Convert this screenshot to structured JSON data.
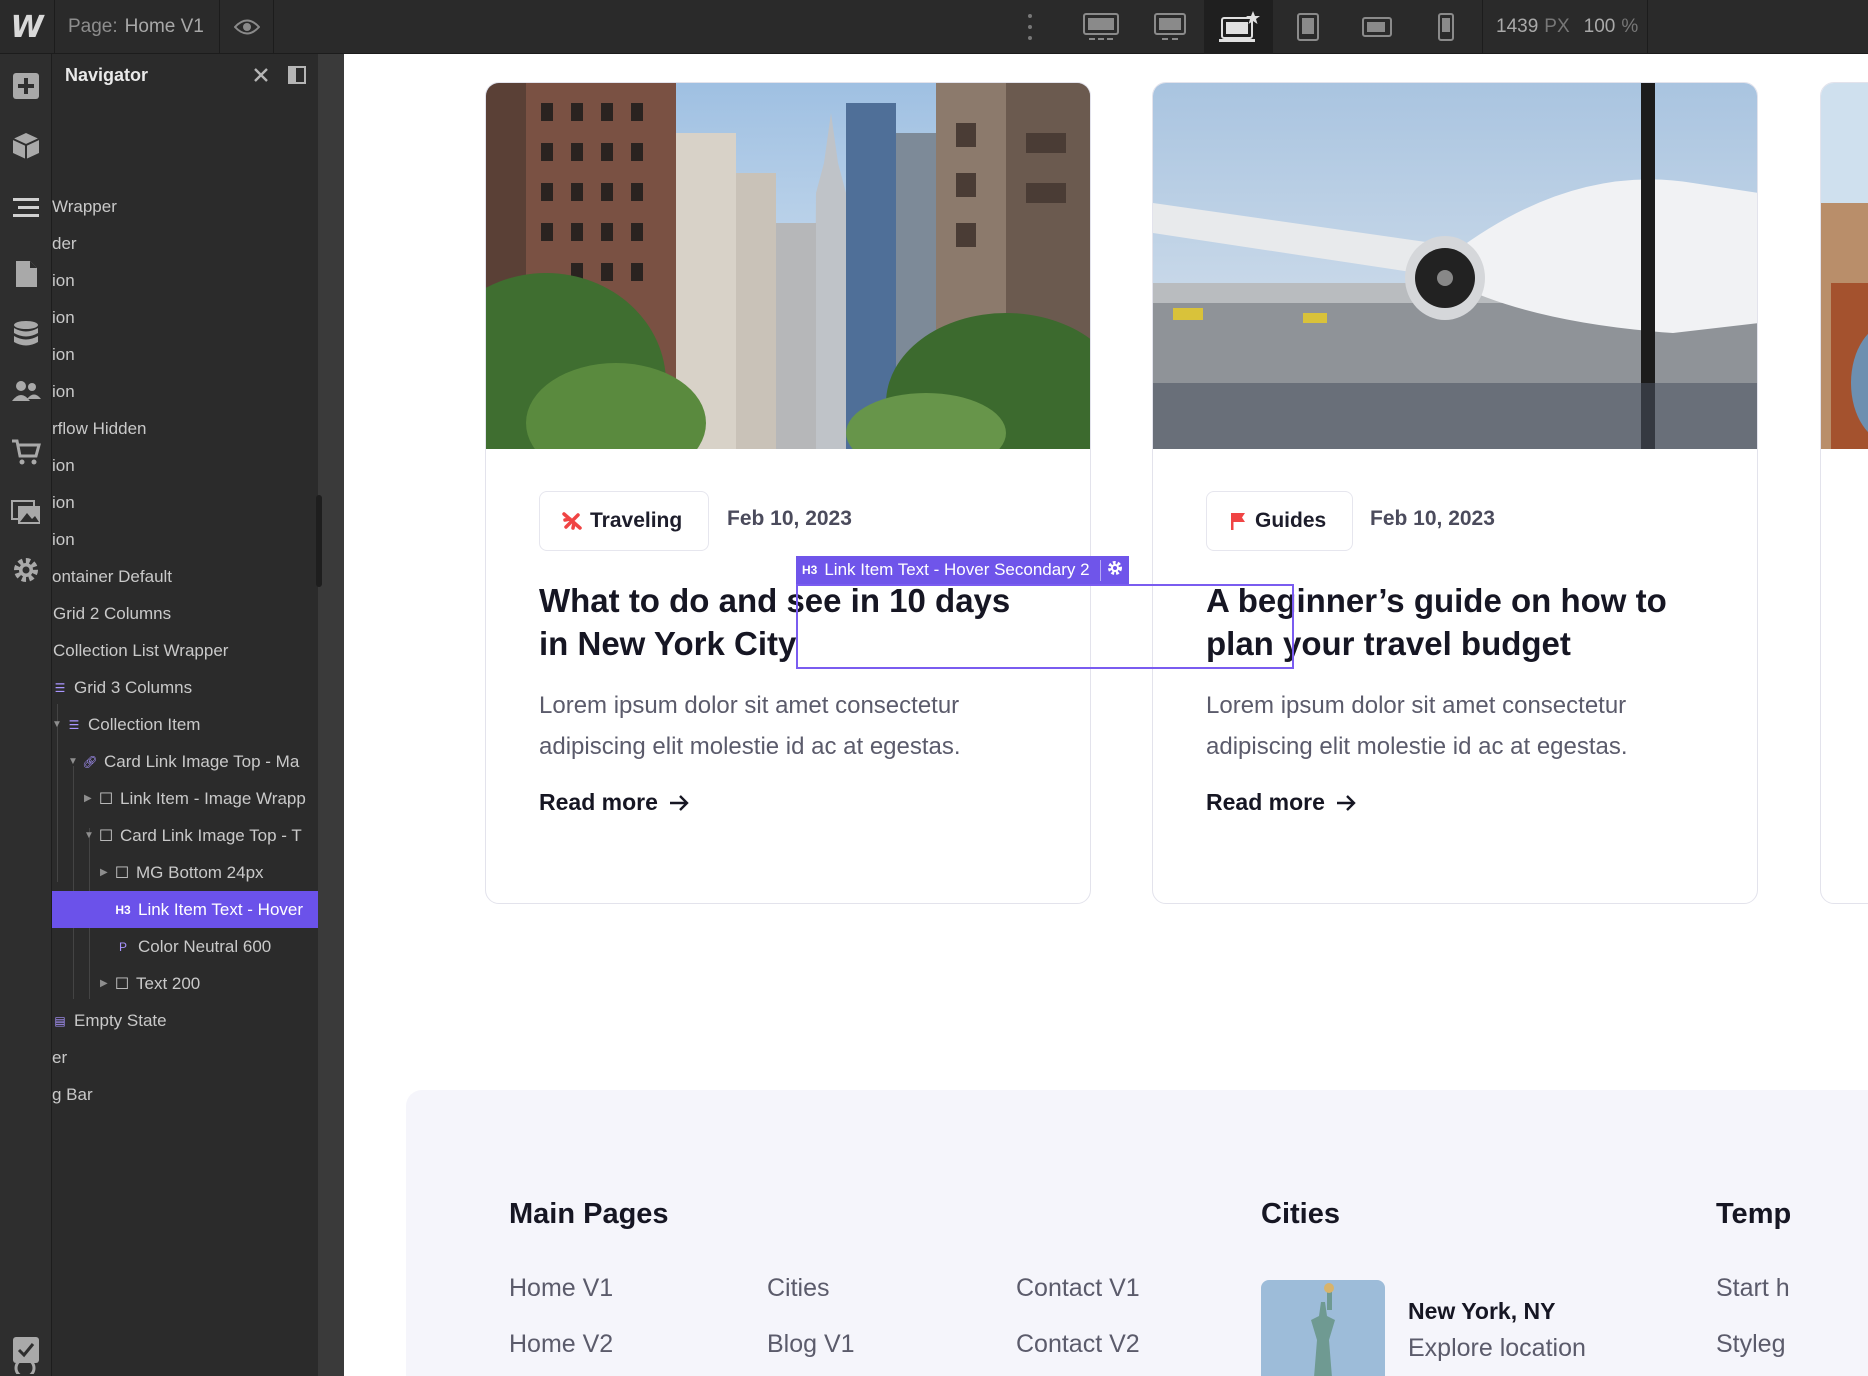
{
  "topbar": {
    "logo": "W",
    "page_label": "Page:",
    "page_name": "Home V1",
    "width_value": "1439",
    "width_unit": "PX",
    "zoom_value": "100",
    "zoom_unit": "%",
    "breakpoints": [
      "desktop-xl-icon",
      "desktop-large-icon",
      "desktop-base-icon",
      "tablet-icon",
      "mobile-landscape-icon",
      "mobile-portrait-icon"
    ]
  },
  "navigator": {
    "title": "Navigator",
    "rows": [
      {
        "label": "Wrapper"
      },
      {
        "label": "der"
      },
      {
        "label": "ion"
      },
      {
        "label": "ion"
      },
      {
        "label": "ion"
      },
      {
        "label": "ion"
      },
      {
        "label": "rflow Hidden"
      },
      {
        "label": "ion"
      },
      {
        "label": "ion"
      },
      {
        "label": "ion"
      },
      {
        "label": "ontainer Default"
      },
      {
        "label": "Grid 2 Columns"
      },
      {
        "label": "Collection List Wrapper"
      },
      {
        "label": "Grid 3 Columns"
      },
      {
        "label": "Collection Item"
      },
      {
        "label": "Card Link Image Top - Ma"
      },
      {
        "label": "Link Item - Image Wrapp"
      },
      {
        "label": "Card Link Image Top - T"
      },
      {
        "label": "MG Bottom 24px"
      },
      {
        "label": "Link Item Text - Hover"
      },
      {
        "label": "Color Neutral 600"
      },
      {
        "label": "Text 200"
      },
      {
        "label": "Empty State"
      },
      {
        "label": "er"
      },
      {
        "label": "g Bar"
      }
    ],
    "tag_h3": "H3",
    "tag_p": "P"
  },
  "selection": {
    "tag": "H3",
    "label": "Link Item Text - Hover Secondary 2"
  },
  "cards": [
    {
      "category": "Traveling",
      "date": "Feb 10, 2023",
      "title": "What to do and see in 10 days in New York City",
      "description": "Lorem ipsum dolor sit amet consectetur adipiscing elit molestie id ac at egestas.",
      "link": "Read more"
    },
    {
      "category": "Guides",
      "date": "Feb 10, 2023",
      "title": "A beginner’s guide on how to plan your travel budget",
      "description": "Lorem ipsum dolor sit amet consectetur adipiscing elit molestie id ac at egestas.",
      "link": "Read more"
    }
  ],
  "footer": {
    "main_heading": "Main Pages",
    "col1": [
      "Home V1",
      "Home V2"
    ],
    "col2": [
      "Cities",
      "Blog V1"
    ],
    "col3": [
      "Contact V1",
      "Contact V2"
    ],
    "cities_heading": "Cities",
    "city_name": "New York, NY",
    "city_link": "Explore location",
    "temp_heading": "Temp",
    "temp_links": [
      "Start h",
      "Styleg"
    ]
  },
  "colors": {
    "accent": "#6b52ea",
    "traveling_icon": "#f04444",
    "guides_icon": "#f04444"
  }
}
